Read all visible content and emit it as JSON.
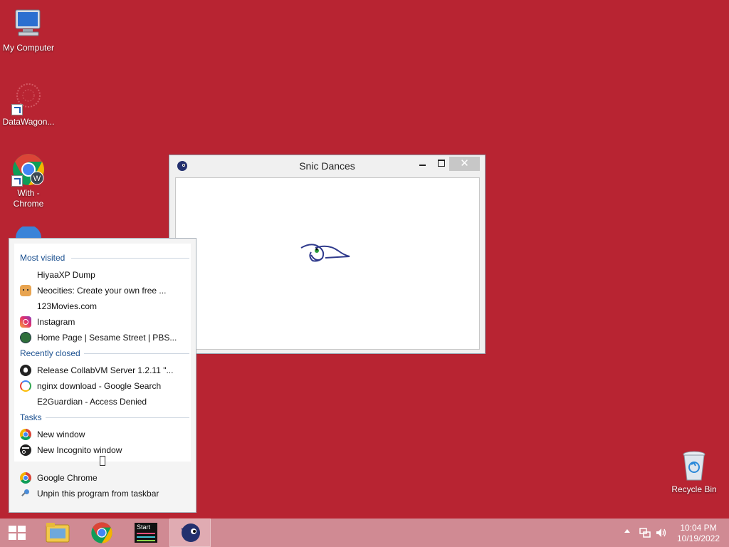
{
  "desktop": {
    "icons": [
      {
        "label": "My Computer"
      },
      {
        "label": "DataWagon..."
      },
      {
        "label": "With -\nChrome",
        "line1": "With -",
        "line2": "Chrome"
      },
      {
        "label": "Recycle Bin"
      }
    ]
  },
  "window": {
    "title": "Snic Dances",
    "close_glyph": "✕"
  },
  "jumplist": {
    "sections": {
      "most_visited": "Most visited",
      "recently_closed": "Recently closed",
      "tasks": "Tasks"
    },
    "most_visited": [
      {
        "label": "HiyaaXP Dump",
        "icon": "blank"
      },
      {
        "label": "Neocities: Create your own free ...",
        "icon": "cat-icon"
      },
      {
        "label": "123Movies.com",
        "icon": "blank"
      },
      {
        "label": "Instagram",
        "icon": "instagram-icon"
      },
      {
        "label": "Home Page | Sesame Street | PBS...",
        "icon": "sesame-icon"
      }
    ],
    "recently_closed": [
      {
        "label": "Release CollabVM Server 1.2.11 \"...",
        "icon": "github-icon"
      },
      {
        "label": "nginx download - Google Search",
        "icon": "google-icon"
      },
      {
        "label": "E2Guardian - Access Denied",
        "icon": "blank"
      }
    ],
    "tasks": [
      {
        "label": "New window",
        "icon": "chrome-icon"
      },
      {
        "label": "New Incognito window",
        "icon": "incognito-icon"
      }
    ],
    "bottom": [
      {
        "label": "Google Chrome",
        "icon": "chrome-icon"
      },
      {
        "label": "Unpin this program from taskbar",
        "icon": "unpin-icon"
      }
    ]
  },
  "taskbar": {
    "start_label": "Start",
    "clock_time": "10:04 PM",
    "clock_date": "10/19/2022"
  },
  "colors": {
    "desktop_bg": "#b82432",
    "taskbar_bg": "#d08a93",
    "section_header": "#1a4f8f"
  }
}
